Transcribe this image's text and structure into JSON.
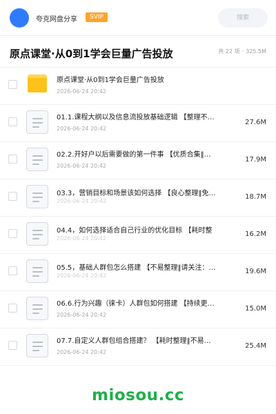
{
  "topbar": {
    "app_name": "夸克网盘分享",
    "badge": "SVIP",
    "search_placeholder": "搜索"
  },
  "header": {
    "title": "原点课堂·从0到1学会巨量广告投放",
    "count": "共 22 项",
    "separator": "·",
    "total_size": "325.5M"
  },
  "items": [
    {
      "type": "folder",
      "icon": "folder-icon",
      "name": "原点课堂·从0到1学会巨量广告投放",
      "date": "2026-06-24 20:42",
      "size": ""
    },
    {
      "type": "file",
      "icon": "document-icon",
      "name": "01.1.课程大纲以及信息流投放基础逻辑 【整理不…",
      "date": "2026-06-24 20:42",
      "size": "27.6M"
    },
    {
      "type": "file",
      "icon": "document-icon",
      "name": "02.2.开好户以后需要做的第一件事 【优质合集‖…",
      "date": "2026-06-24 20:42",
      "size": "17.9M"
    },
    {
      "type": "file",
      "icon": "document-icon",
      "name": "03.3，营销目标和场景该如何选择 【良心整理‖免…",
      "date": "2026-06-24 20:42",
      "size": "18.7M",
      "wrap": true
    },
    {
      "type": "file",
      "icon": "document-icon",
      "name": "04.4，如何选择适合自己行业的优化目标 【耗时整",
      "date": "2026-06-24 20:42",
      "size": "16.2M",
      "wrap": true
    },
    {
      "type": "file",
      "icon": "document-icon",
      "name": "05.5，基础人群包怎么搭建 【不易整理‖请关注：…",
      "date": "2026-06-24 20:42",
      "size": "19.6M",
      "wrap": true
    },
    {
      "type": "file",
      "icon": "document-icon",
      "name": "06.6.行为兴趣（徕卡）人群包如何搭建 【持续更…",
      "date": "2026-06-24 20:42",
      "size": "15.0M"
    },
    {
      "type": "file",
      "icon": "document-icon",
      "name": "07.7.自定义人群包组合搭建？ 【耗时整理‖不易…",
      "date": "2026-06-24 20:42",
      "size": "25.4M"
    }
  ],
  "watermark": "miosou.cc"
}
